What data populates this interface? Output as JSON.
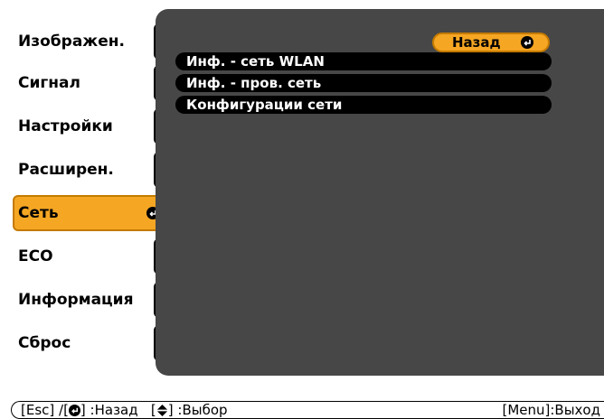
{
  "menu": {
    "items": [
      {
        "label": "Изображен."
      },
      {
        "label": "Сигнал"
      },
      {
        "label": "Настройки"
      },
      {
        "label": "Расширен."
      },
      {
        "label": "Сеть"
      },
      {
        "label": "ECO"
      },
      {
        "label": "Информация"
      },
      {
        "label": "Сброс"
      }
    ],
    "active_index": 4,
    "active_icon": "enter-icon"
  },
  "panel": {
    "back_label": "Назад",
    "back_icon": "enter-icon",
    "items": [
      {
        "label": "Инф. - сеть WLAN"
      },
      {
        "label": "Инф. - пров. сеть"
      },
      {
        "label": "Конфигурации сети"
      }
    ]
  },
  "help": {
    "esc_prefix": "[Esc] /[",
    "esc_suffix": "] :Назад",
    "select_prefix": "[",
    "select_suffix": "] :Выбор",
    "exit_text": "[Menu]:Выход"
  },
  "colors": {
    "panel_bg": "#474747",
    "accent": "#f5a623",
    "item_bg": "#000000"
  }
}
